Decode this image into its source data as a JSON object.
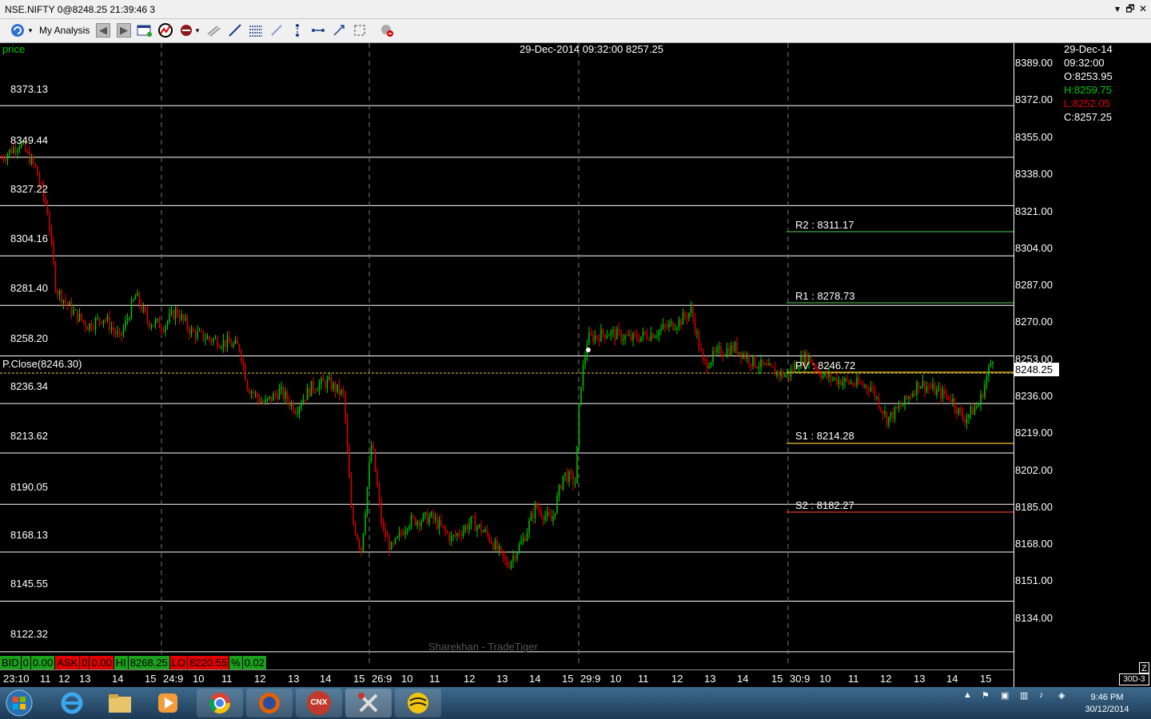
{
  "window": {
    "title": "NSE.NIFTY 0@8248.25 21:39:46 3",
    "controls": {
      "minimize": "▾",
      "restore": "🗗",
      "close": "✕"
    }
  },
  "toolbar": {
    "analysis_label": "My Analysis",
    "icons": [
      "refresh-icon",
      "back-icon",
      "forward-icon",
      "new-window-icon",
      "indicator-icon",
      "drawing-icon",
      "line-tool-icon",
      "trendline-icon",
      "fibonacci-icon",
      "segment-icon",
      "vertical-line-icon",
      "horizontal-segment-icon",
      "crosshair-icon",
      "zoom-icon",
      "delete-icon"
    ]
  },
  "chart": {
    "series_label": "price",
    "hover_info": "29-Dec-2014  09:32:00  8257.25",
    "prev_close_label": "P.Close(8246.30)",
    "last_price": "8248.25",
    "watermark": "Sharekhan - TradeTiger",
    "level_labels": [
      "8373.13",
      "8349.44",
      "8327.22",
      "8304.16",
      "8281.40",
      "8258.20",
      "8236.34",
      "8213.62",
      "8190.05",
      "8168.13",
      "8145.55",
      "8122.32"
    ],
    "pivots": [
      {
        "label": "R2 : 8311.17",
        "color": "#3a8a3a"
      },
      {
        "label": "R1 : 8278.73",
        "color": "#3a8a3a"
      },
      {
        "label": "PV : 8246.72",
        "color": "#c8a020"
      },
      {
        "label": "S1 : 8214.28",
        "color": "#c8a020"
      },
      {
        "label": "S2 : 8182.27",
        "color": "#c03020"
      }
    ],
    "y_ticks": [
      "8389.00",
      "8372.00",
      "8355.00",
      "8338.00",
      "8321.00",
      "8304.00",
      "8287.00",
      "8270.00",
      "8253.00",
      "8236.00",
      "8219.00",
      "8202.00",
      "8185.00",
      "8168.00",
      "8151.00",
      "8134.00"
    ],
    "x_ticks": [
      "23:10",
      "11",
      "12",
      "13",
      "14",
      "15",
      "24:9",
      "10",
      "11",
      "12",
      "13",
      "14",
      "15",
      "26:9",
      "10",
      "11",
      "12",
      "13",
      "14",
      "15",
      "29:9",
      "10",
      "11",
      "12",
      "13",
      "14",
      "15",
      "30:9",
      "10",
      "11",
      "12",
      "13",
      "14",
      "15"
    ]
  },
  "ohlc": {
    "date": "29-Dec-14",
    "time": "09:32:00",
    "open": "O:8253.95",
    "high": "H:8259.75",
    "low": "L:8252.05",
    "close": "C:8257.25"
  },
  "status": {
    "bid_label": "BID",
    "bid_qty": "0",
    "bid_price": "0.00",
    "ask_label": "ASK",
    "ask_qty": "0",
    "ask_price": "0.00",
    "hi_label": "HI",
    "hi_value": "8268.25",
    "lo_label": "LO",
    "lo_value": "8220.55",
    "pct_label": "%",
    "pct_value": "0.02"
  },
  "axis_buttons": {
    "zoom": "Z",
    "period": "30D-3"
  },
  "taskbar": {
    "apps": [
      "windows-start-icon",
      "internet-explorer-icon",
      "file-explorer-icon",
      "media-player-icon",
      "chrome-icon",
      "firefox-icon",
      "cnx-app-icon",
      "tools-icon",
      "tradetiger-icon"
    ],
    "cnx_text": "CNX",
    "time": "9:46 PM",
    "date": "30/12/2014"
  },
  "colors": {
    "up": "#00c800",
    "down": "#e00000",
    "level_line": "#ffffff",
    "prev_close": "#e8d060"
  }
}
